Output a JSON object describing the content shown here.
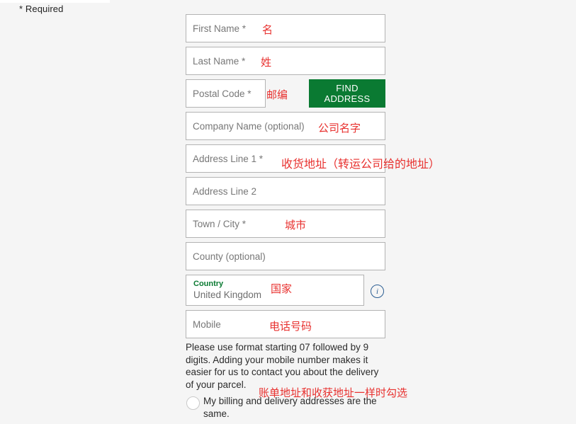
{
  "page": {
    "required_note": "* Required",
    "accent_green": "#0a7a32",
    "annotation_red": "#e8312f",
    "info_blue": "#2a5d92",
    "background": "#f5f5f5"
  },
  "form": {
    "fields": [
      {
        "placeholder": "First Name *",
        "annotation": "名"
      },
      {
        "placeholder": "Last Name *",
        "annotation": "姓"
      },
      {
        "placeholder": "Postal Code *",
        "annotation": "邮编"
      },
      {
        "placeholder": "Company Name (optional)",
        "annotation": "公司名字"
      },
      {
        "placeholder": "Address Line 1 *",
        "annotation": "收货地址（转运公司给的地址）"
      },
      {
        "placeholder": "Address Line 2",
        "annotation": ""
      },
      {
        "placeholder": "Town / City *",
        "annotation": "城市"
      },
      {
        "placeholder": "County (optional)",
        "annotation": ""
      },
      {
        "placeholder": "Mobile",
        "annotation": "电话号码"
      }
    ],
    "find_address_button": "FIND ADDRESS",
    "country": {
      "label": "Country",
      "value": "United Kingdom",
      "annotation": "国家",
      "info_icon_glyph": "i"
    },
    "mobile_helper": "Please use format starting 07 followed by 9 digits. Adding your mobile number makes it easier for us to contact you about the delivery of your parcel.",
    "billing_checkbox": {
      "label": "My billing and delivery addresses are the same.",
      "annotation": "账单地址和收获地址一样时勾选",
      "checked": false
    }
  }
}
